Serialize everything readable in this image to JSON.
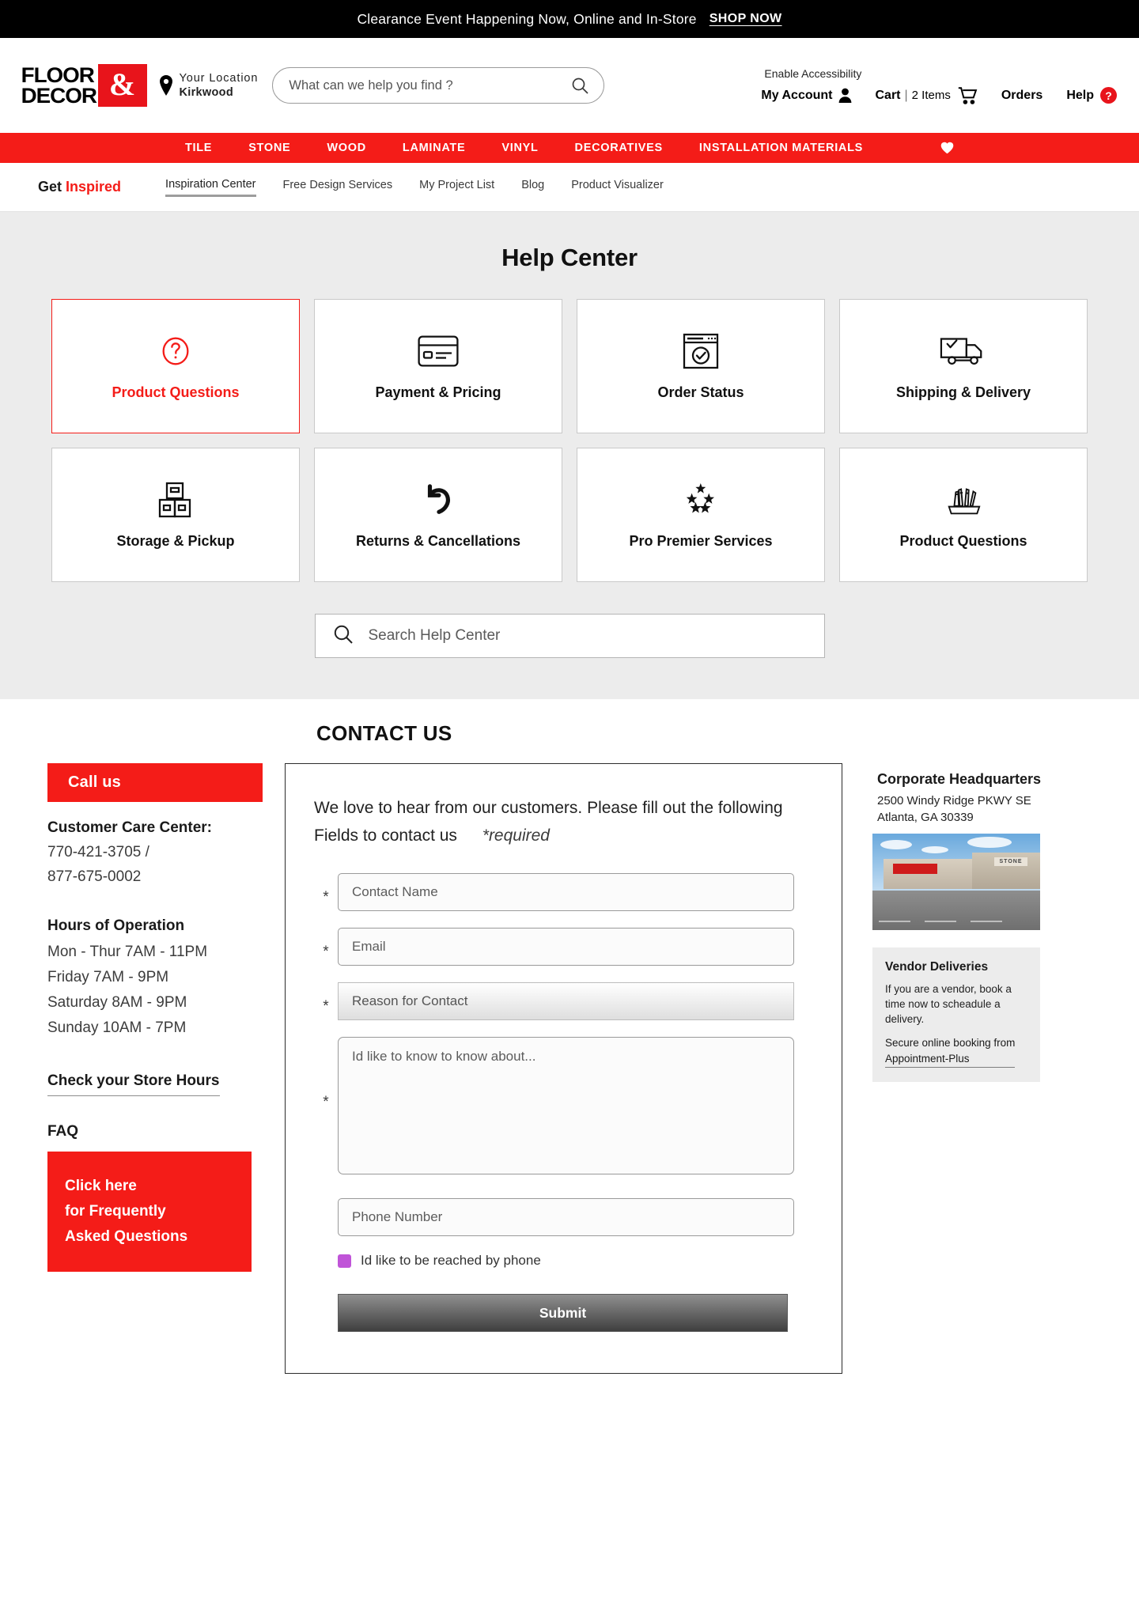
{
  "promo": {
    "text": "Clearance Event Happening Now, Online and In-Store",
    "cta": "SHOP NOW"
  },
  "header": {
    "logo_line1": "FLOOR",
    "logo_line2": "DECOR",
    "logo_amp": "&",
    "location_label": "Your Location",
    "location_store": "Kirkwood",
    "search_placeholder": "What can we help you find ?",
    "search_value": "",
    "accessibility": "Enable Accessibility",
    "my_account": "My Account",
    "cart_label": "Cart",
    "cart_divider": "|",
    "cart_items": "2 Items",
    "orders": "Orders",
    "help": "Help",
    "help_badge": "?"
  },
  "mainnav": {
    "items": [
      {
        "label": "TILE"
      },
      {
        "label": "STONE"
      },
      {
        "label": "WOOD"
      },
      {
        "label": "LAMINATE"
      },
      {
        "label": "VINYL"
      },
      {
        "label": "DECORATIVES"
      },
      {
        "label": "INSTALLATION MATERIALS"
      }
    ],
    "wishlist_icon": "heart-icon"
  },
  "inspire": {
    "brand_a": "Get",
    "brand_b": "Inspired",
    "links": [
      {
        "label": "Inspiration Center",
        "active": true
      },
      {
        "label": "Free Design Services",
        "active": false
      },
      {
        "label": "My Project List",
        "active": false
      },
      {
        "label": "Blog",
        "active": false
      },
      {
        "label": "Product Visualizer",
        "active": false
      }
    ]
  },
  "help_center": {
    "title": "Help Center",
    "tiles": [
      {
        "label": "Product Questions",
        "icon": "question-mark-circle-icon",
        "selected": true
      },
      {
        "label": "Payment & Pricing",
        "icon": "credit-card-icon",
        "selected": false
      },
      {
        "label": "Order Status",
        "icon": "browser-window-check-icon",
        "selected": false
      },
      {
        "label": "Shipping & Delivery",
        "icon": "delivery-truck-icon",
        "selected": false
      },
      {
        "label": "Storage & Pickup",
        "icon": "stacked-boxes-icon",
        "selected": false
      },
      {
        "label": "Returns & Cancellations",
        "icon": "undo-arrow-icon",
        "selected": false
      },
      {
        "label": "Pro Premier Services",
        "icon": "five-stars-icon",
        "selected": false
      },
      {
        "label": "Product Questions",
        "icon": "paint-brushes-icon",
        "selected": false
      }
    ],
    "search_placeholder": "Search Help Center",
    "search_value": ""
  },
  "contact": {
    "title": "CONTACT US",
    "left": {
      "call_us": "Call us",
      "care_title": "Customer Care Center",
      "care_title_colon": ":",
      "phone_1": "770-421-3705 /",
      "phone_2": "877-675-0002",
      "hours_title": "Hours of Operation",
      "hours": [
        "Mon - Thur  7AM - 11PM",
        "Friday  7AM - 9PM",
        "Saturday  8AM - 9PM",
        "Sunday  10AM - 7PM"
      ],
      "store_hours_link": "Check your Store Hours",
      "faq_title": "FAQ",
      "faq_button_line1": "Click here",
      "faq_button_line2": "for Frequently",
      "faq_button_line3": "Asked Questions"
    },
    "form": {
      "intro": "We love to hear from our customers. Please fill out the following Fields to contact us",
      "required_note": "*required",
      "star": "*",
      "name_placeholder": "Contact Name",
      "name_value": "",
      "email_placeholder": "Email",
      "email_value": "",
      "reason_value": "Reason for Contact",
      "message_placeholder": "Id like to know to know about...",
      "message_value": "",
      "phone_placeholder": "Phone Number",
      "phone_value": "",
      "phone_checkbox_label": "Id like to be reached by phone",
      "submit_label": "Submit"
    },
    "right": {
      "hq_title": "Corporate Headquarters",
      "hq_addr_line1": "2500 Windy Ridge PKWY SE",
      "hq_addr_line2": "Atlanta, GA 30339",
      "photo_sign": "STONE",
      "vendor_title": "Vendor Deliveries",
      "vendor_text": "If you are a vendor, book a time now to scheadule a delivery.",
      "vendor_link_line1": "Secure online booking from",
      "vendor_link_line2": "Appointment-Plus"
    }
  }
}
